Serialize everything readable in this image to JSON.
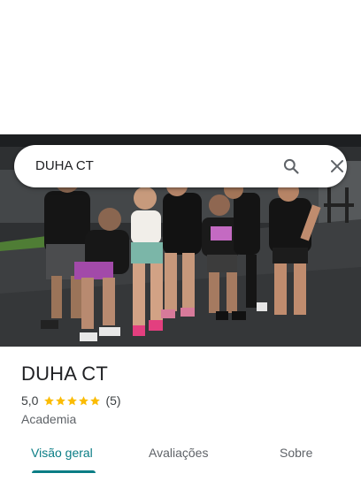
{
  "search": {
    "query": "DUHA CT"
  },
  "place": {
    "name": "DUHA CT",
    "rating": "5,0",
    "stars": 5,
    "review_count": "(5)",
    "category": "Academia",
    "photo": "group-photo-gym"
  },
  "tabs": [
    {
      "label": "Visão geral",
      "active": true
    },
    {
      "label": "Avaliações",
      "active": false
    },
    {
      "label": "Sobre",
      "active": false
    }
  ],
  "colors": {
    "accent": "#0a7d85",
    "star": "#fbbc04"
  }
}
